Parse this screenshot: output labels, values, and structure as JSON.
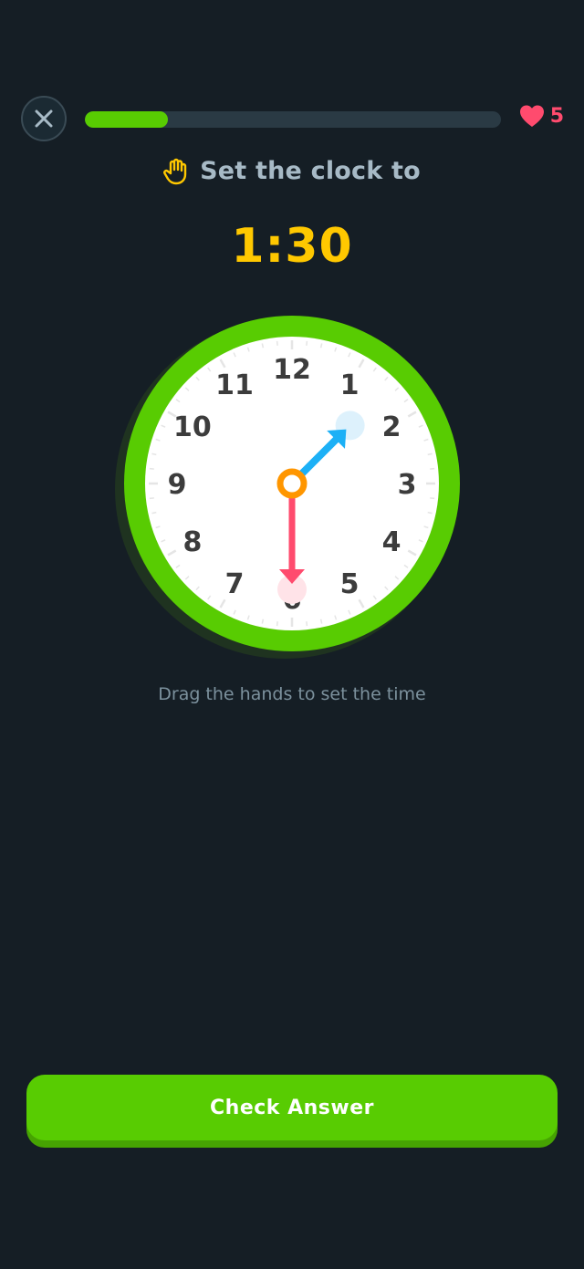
{
  "header": {
    "close_icon": "close-icon",
    "progress": 0.2,
    "progress_color": "#58cc02",
    "hearts_icon": "heart-icon",
    "hearts_count": "5",
    "hearts_color": "#ff4b6e"
  },
  "prompt": {
    "icon": "hand-icon",
    "text": "Set the clock to"
  },
  "target": {
    "time": "1:30",
    "color": "#ffc800"
  },
  "clock": {
    "numbers": [
      "12",
      "1",
      "2",
      "3",
      "4",
      "5",
      "6",
      "7",
      "8",
      "9",
      "10",
      "11"
    ],
    "hour_hand_angle_deg": 45,
    "minute_hand_angle_deg": 180,
    "hour_hand_color": "#1cb0f6",
    "minute_hand_color": "#ff4b6e",
    "center_color": "#ff9600",
    "rim_color": "#58cc02"
  },
  "hint": "Drag the hands to set the time",
  "footer": {
    "check_label": "Check Answer"
  }
}
